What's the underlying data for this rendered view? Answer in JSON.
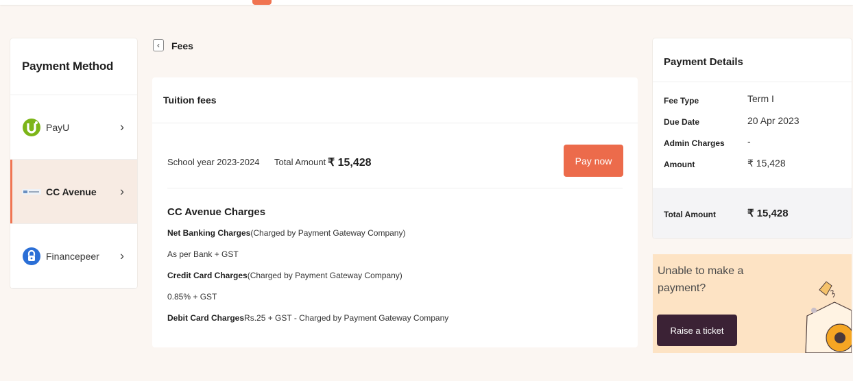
{
  "colors": {
    "accent": "#ec6b4b",
    "dark_button": "#3b2235",
    "help_bg": "#fde3c4",
    "page_bg": "#fbf6f2"
  },
  "payment_method": {
    "title": "Payment Method",
    "items": [
      {
        "label": "PayU",
        "icon": "payu-logo-icon",
        "active": false
      },
      {
        "label": "CC Avenue",
        "icon": "cc-avenue-logo-icon",
        "active": true
      },
      {
        "label": "Financepeer",
        "icon": "financepeer-logo-icon",
        "active": false
      }
    ]
  },
  "fees": {
    "title": "Fees",
    "tuition_title": "Tuition fees",
    "school_year": "School year 2023-2024",
    "total_label": "Total Amount",
    "total_value": "₹ 15,428",
    "pay_button": "Pay now",
    "charges_title": "CC Avenue Charges",
    "net_banking_label": "Net Banking Charges",
    "net_banking_note": "(Charged by Payment Gateway Company)",
    "net_banking_value": "As per Bank + GST",
    "credit_card_label": "Credit Card Charges",
    "credit_card_note": "(Charged by Payment Gateway Company)",
    "credit_card_value": "0.85% + GST",
    "debit_card_label": "Debit Card Charges",
    "debit_card_value": "Rs.25 + GST - Charged by Payment Gateway Company"
  },
  "payment_details": {
    "title": "Payment Details",
    "fee_type_label": "Fee Type",
    "fee_type_value": "Term I",
    "due_date_label": "Due Date",
    "due_date_value": "20 Apr 2023",
    "admin_label": "Admin Charges",
    "admin_value": "-",
    "amount_label": "Amount",
    "amount_value": "₹ 15,428",
    "total_label": "Total Amount",
    "total_value": "₹ 15,428"
  },
  "help": {
    "text": "Unable to make a payment?",
    "button": "Raise a ticket"
  }
}
